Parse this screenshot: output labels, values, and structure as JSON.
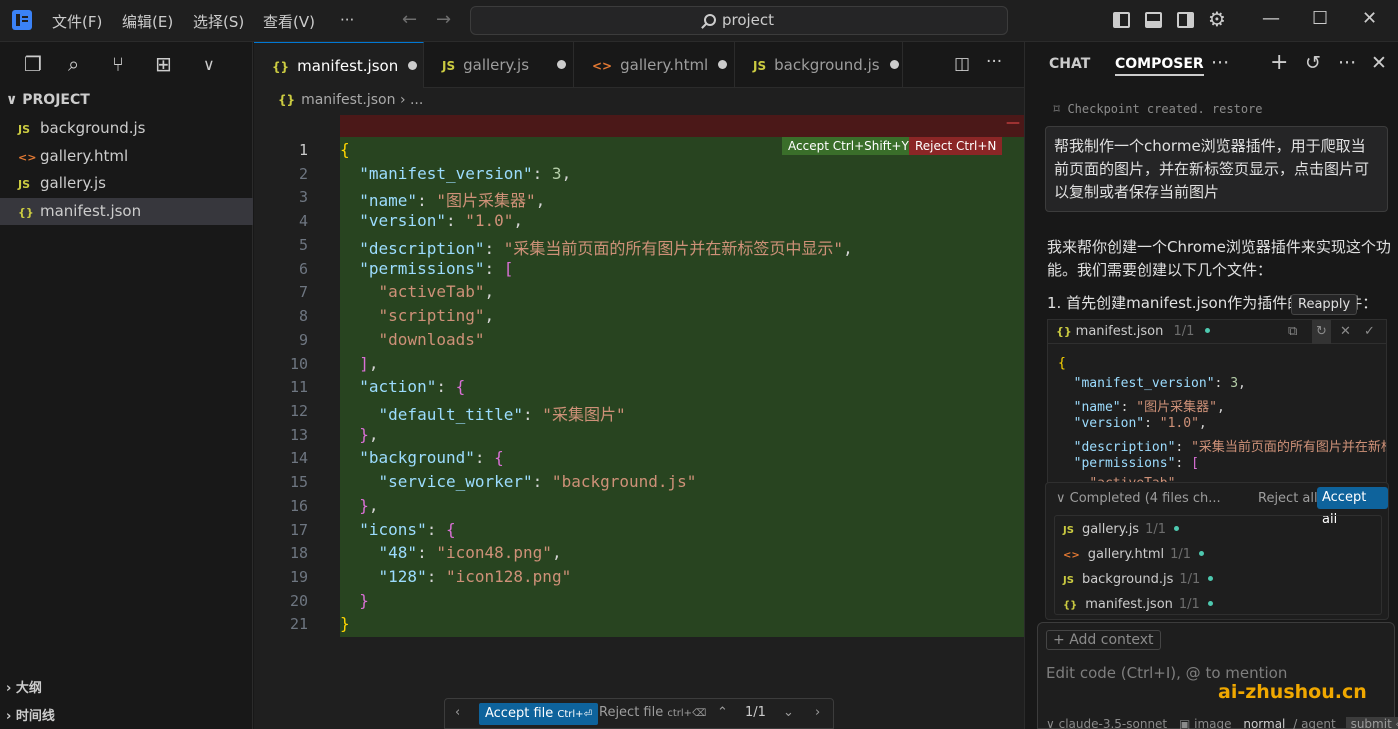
{
  "menus": [
    "文件(F)",
    "编辑(E)",
    "选择(S)",
    "查看(V)",
    "···"
  ],
  "search": "project",
  "explorer": {
    "project": "PROJECT",
    "files": [
      {
        "icon": "JS",
        "name": "background.js"
      },
      {
        "icon": "<>",
        "name": "gallery.html"
      },
      {
        "icon": "JS",
        "name": "gallery.js"
      },
      {
        "icon": "{}",
        "name": "manifest.json"
      }
    ],
    "outline": "大纲",
    "timeline": "时间线"
  },
  "tabs": [
    {
      "icon": "{}",
      "name": "manifest.json"
    },
    {
      "icon": "JS",
      "name": "gallery.js"
    },
    {
      "icon": "<>",
      "name": "gallery.html"
    },
    {
      "icon": "JS",
      "name": "background.js"
    }
  ],
  "breadcrumb": {
    "file": "manifest.json",
    "rest": "› ..."
  },
  "diff": {
    "accept": "Accept Ctrl+Shift+Y",
    "reject": "Reject Ctrl+N"
  },
  "line_numbers": [
    "1",
    "2",
    "3",
    "4",
    "5",
    "6",
    "7",
    "8",
    "9",
    "10",
    "11",
    "12",
    "13",
    "14",
    "15",
    "16",
    "17",
    "18",
    "19",
    "20",
    "21"
  ],
  "code": {
    "manifest_version": "3",
    "name": "图片采集器",
    "version": "1.0",
    "description": "采集当前页面的所有图片并在新标签页中显示",
    "permissions": [
      "activeTab",
      "scripting",
      "downloads"
    ],
    "default_title": "采集图片",
    "service_worker": "background.js",
    "icon48": "icon48.png",
    "icon128": "icon128.png"
  },
  "filebar": {
    "accept": "Accept file",
    "accept_key": "Ctrl+⏎",
    "reject": "Reject file",
    "reject_key": "ctrl+⌫",
    "count": "1/1"
  },
  "panel": {
    "tab_chat": "CHAT",
    "tab_composer": "COMPOSER",
    "checkpoint": "Checkpoint created. restore",
    "user_message": "帮我制作一个chorme浏览器插件，用于爬取当前页面的图片，并在新标签页显示，点击图片可以复制或者保存当前图片",
    "reply": "我来帮你创建一个Chrome浏览器插件来实现这个功能。我们需要创建以下几个文件：",
    "step": "1. 首先创建manifest.json作为插件的配置文件：",
    "tooltip": "Reapply",
    "codeblock_file": "manifest.json",
    "codeblock_count": "1/1",
    "completed": "Completed (4 files ch...",
    "reject_all": "Reject all",
    "accept_all": "Accept all",
    "changed_files": [
      {
        "icon": "JS",
        "name": "gallery.js",
        "count": "1/1"
      },
      {
        "icon": "<>",
        "name": "gallery.html",
        "count": "1/1"
      },
      {
        "icon": "JS",
        "name": "background.js",
        "count": "1/1"
      },
      {
        "icon": "{}",
        "name": "manifest.json",
        "count": "1/1"
      }
    ],
    "add_context": "Add context",
    "input_placeholder": "Edit code (Ctrl+I), @ to mention",
    "watermark": "ai-zhushou.cn",
    "model": "claude-3.5-sonnet",
    "image": "image",
    "mode": "normal",
    "agent": "/ agent",
    "submit": "submit ⏎"
  }
}
